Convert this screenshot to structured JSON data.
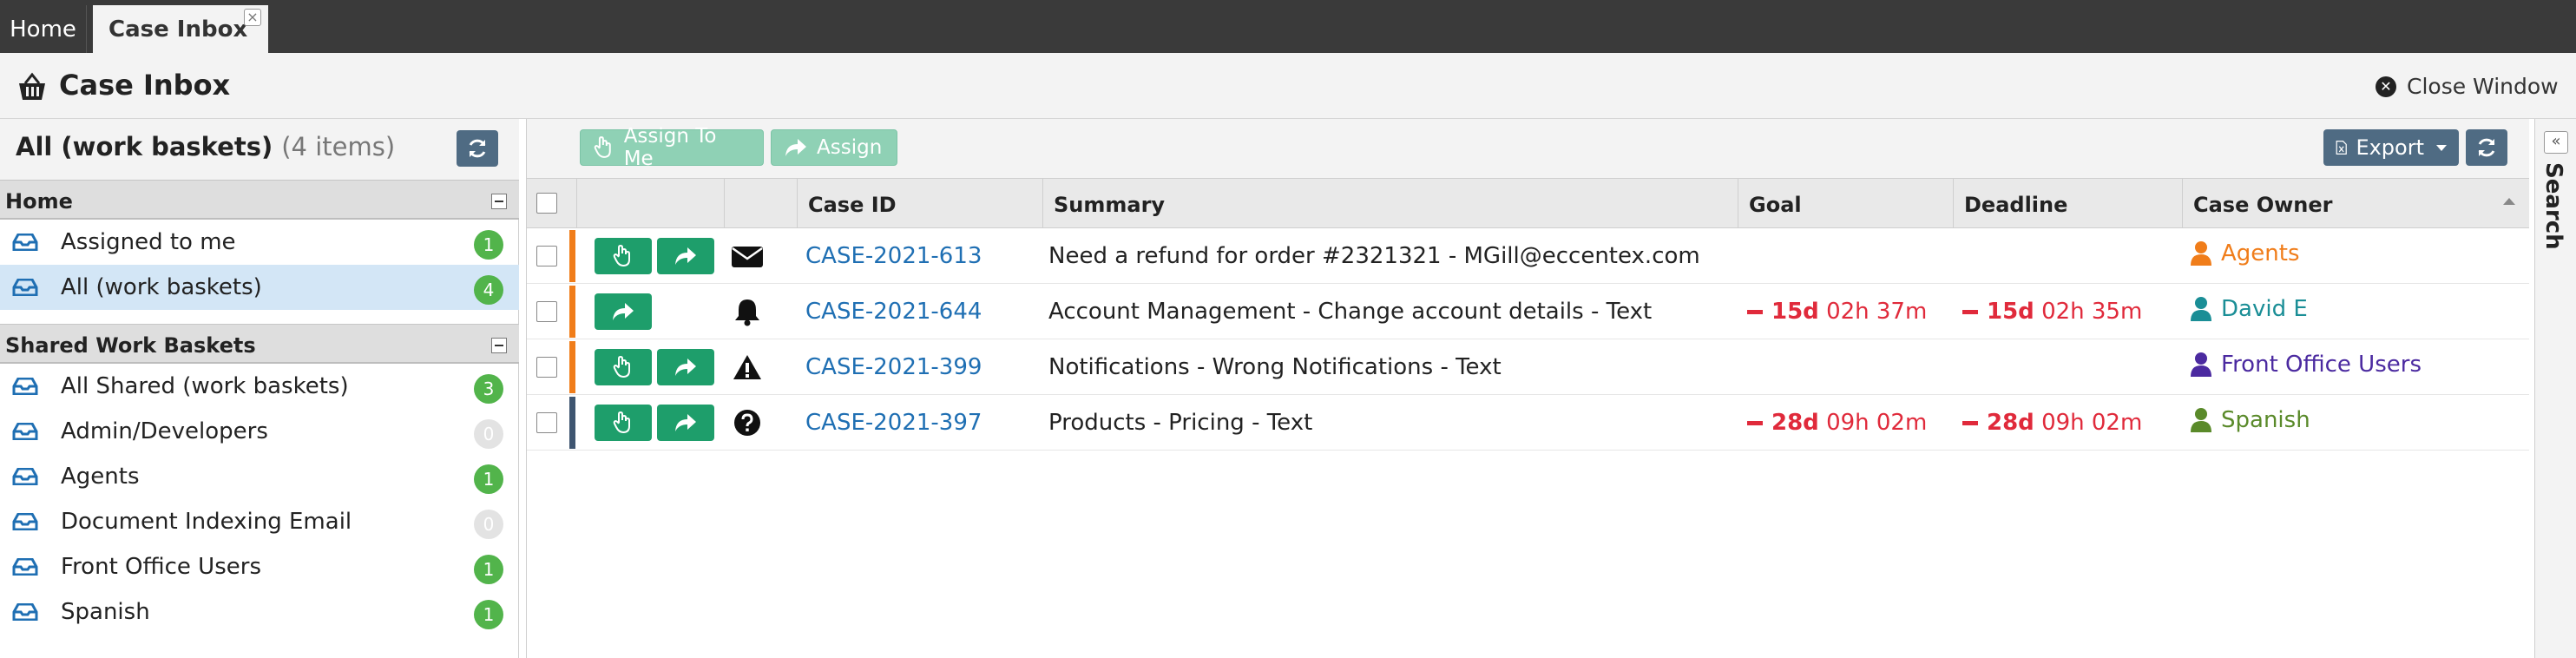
{
  "tabs": {
    "home": "Home",
    "active": "Case Inbox",
    "close_glyph": "×"
  },
  "header": {
    "title": "Case Inbox",
    "close_window": "Close Window"
  },
  "sidebar": {
    "title": "All (work baskets)",
    "count": "(4 items)",
    "groups": [
      {
        "label": "Home",
        "items": [
          {
            "label": "Assigned to me",
            "count": "1",
            "badge": "green",
            "selected": false
          },
          {
            "label": "All (work baskets)",
            "count": "4",
            "badge": "green",
            "selected": true
          }
        ]
      },
      {
        "label": "Shared Work Baskets",
        "items": [
          {
            "label": "All Shared (work baskets)",
            "count": "3",
            "badge": "green",
            "selected": false
          },
          {
            "label": "Admin/Developers",
            "count": "0",
            "badge": "gray",
            "selected": false
          },
          {
            "label": "Agents",
            "count": "1",
            "badge": "green",
            "selected": false
          },
          {
            "label": "Document Indexing Email",
            "count": "0",
            "badge": "gray",
            "selected": false
          },
          {
            "label": "Front Office Users",
            "count": "1",
            "badge": "green",
            "selected": false
          },
          {
            "label": "Spanish",
            "count": "1",
            "badge": "green",
            "selected": false
          }
        ]
      }
    ]
  },
  "toolbar": {
    "assign_to_me": "Assign To Me",
    "assign": "Assign",
    "export": "Export"
  },
  "columns": {
    "case_id": "Case ID",
    "summary": "Summary",
    "goal": "Goal",
    "deadline": "Deadline",
    "case_owner": "Case Owner"
  },
  "rows": [
    {
      "case_id": "CASE-2021-613",
      "summary": "Need a refund for order #2321321 - MGill@eccentex.com",
      "type_icon": "envelope-icon",
      "stripe": "#f07d1a",
      "actions": [
        "hand-icon",
        "forward-icon"
      ],
      "goal_days": "",
      "goal_time": "",
      "deadline_days": "",
      "deadline_time": "",
      "owner": "Agents",
      "owner_color": "#f07d1a"
    },
    {
      "case_id": "CASE-2021-644",
      "summary": "Account Management - Change account details - Text",
      "type_icon": "bell-icon",
      "stripe": "#f07d1a",
      "actions": [
        "forward-icon"
      ],
      "goal_days": "15d",
      "goal_time": "02h 37m",
      "deadline_days": "15d",
      "deadline_time": "02h 35m",
      "owner": "David E",
      "owner_color": "#1a8e96"
    },
    {
      "case_id": "CASE-2021-399",
      "summary": "Notifications - Wrong Notifications - Text",
      "type_icon": "warning-icon",
      "stripe": "#f07d1a",
      "actions": [
        "hand-icon",
        "forward-icon"
      ],
      "goal_days": "",
      "goal_time": "",
      "deadline_days": "",
      "deadline_time": "",
      "owner": "Front Office Users",
      "owner_color": "#4b2aa0"
    },
    {
      "case_id": "CASE-2021-397",
      "summary": "Products - Pricing - Text",
      "type_icon": "question-icon",
      "stripe": "#3e5570",
      "actions": [
        "hand-icon",
        "forward-icon"
      ],
      "goal_days": "28d",
      "goal_time": "09h 02m",
      "deadline_days": "28d",
      "deadline_time": "09h 02m",
      "owner": "Spanish",
      "owner_color": "#5a8a2a"
    }
  ],
  "search_rail": {
    "label": "Search",
    "expand_glyph": "«"
  }
}
